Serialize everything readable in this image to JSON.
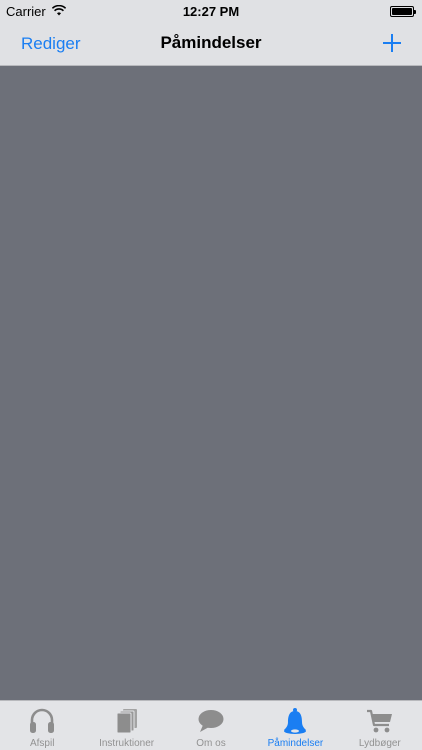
{
  "status_bar": {
    "carrier": "Carrier",
    "time": "12:27 PM"
  },
  "nav": {
    "edit_label": "Rediger",
    "title": "Påmindelser",
    "add_icon": "plus-icon"
  },
  "tabs": [
    {
      "label": "Afspil",
      "icon": "headphones-icon",
      "active": false
    },
    {
      "label": "Instruktioner",
      "icon": "documents-icon",
      "active": false
    },
    {
      "label": "Om os",
      "icon": "speech-bubble-icon",
      "active": false
    },
    {
      "label": "Påmindelser",
      "icon": "bell-icon",
      "active": true
    },
    {
      "label": "Lydbøger",
      "icon": "cart-icon",
      "active": false
    }
  ],
  "colors": {
    "accent": "#1a7ef2",
    "inactive": "#929292",
    "content_background": "#6d7079",
    "bar_background": "#e0e1e4"
  }
}
